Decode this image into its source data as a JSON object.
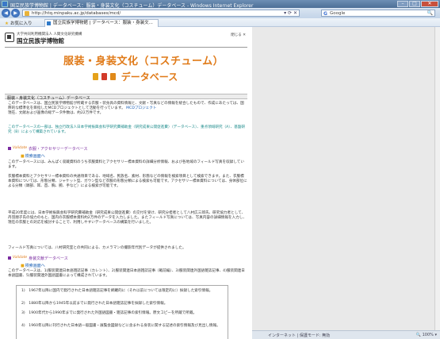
{
  "window": {
    "title": "国立民族学博物館 | データベース：服装・身装文化（コスチューム）データベース - Windows Internet Explorer",
    "minimize": "–",
    "maximize": "□",
    "close": "✕"
  },
  "address": {
    "back": "◀",
    "forward": "▶",
    "url": "http://htq.minpaku.ac.jp/databases/mcd/",
    "tools": "▾ ⟳ ✕"
  },
  "search": {
    "logo": "G",
    "placeholder": "Google",
    "button": "🔍"
  },
  "favorites": {
    "label": "お気に入り"
  },
  "tab": {
    "label": "国立民族学博物館 | データベース：服装・身装文..."
  },
  "site": {
    "sub": "大学共同利用機関法人 人間文化研究機構",
    "name": "国立民族学博物館",
    "close_label": "閉じる ✕"
  },
  "banner": {
    "line1": "服装・身装文化（コスチューム）",
    "line2": "データベース"
  },
  "intro": {
    "heading": "服装・身装文化（コスチューム）データベース",
    "p1": "このデータベースは、国立民族学博物館が所蔵する衣服・装身具の資料情報と、文献・写真などの情報を統合したもので、作成にあたっては、国際的な標準化を目指したMCDプロジェクトとして活動を行っています。",
    "p1_link": "MCDプロジェクト",
    "p1b": "現在、文献および画像の総データ件数は、約22万件です。",
    "p2": "このデータベースの一部は、独立行政法人日本学術振興会科学研究費補助金〈研究成果公開促進費〉（データベース）、重点領域研究（A）、基盤研究（B）によって構築されています。"
  },
  "sec1": {
    "kind": "Validate",
    "title": "衣服・アクセサリーデータベース",
    "search_link": "検索画面へ",
    "p1": "このデータベースには、みんぱく収蔵資料のうち衣服資料とアクセサリー標本資料の詳細分析情報、および各地域のフィールド写真を収録しています。",
    "p2": "衣服標本資料とアクセサリー標本資料の共通項目である、地域名、民族名、素材、形態などの情報を検索項目として検索できます。また、衣服標本資料については、形態分類、ジャケット型、ガウン型など衣服の形態分類による検索も可能です。アクセサリー標本資料については、身体部位による分類（頭部、耳、首、胸、腕、手など）による検索が可能です。",
    "p3": "平成20年度には、日本学術振興会科学研究費補助金（研究成果公開促進費）の交付を受け、研究分担者として八村広三郎氏、研究協力者として、丹羽朋子氏の協力のもと、国内の衣服標本資料約2万件のデータを入力しました。またフィールド写真については、写真内容の詳細情報を入力し、現在の衣服との対応を検討することで、利用しやすいデータベースの構築を行いました。",
    "p4": "フィールド写真については、八村研究室との共同による、カメラマンの撮影年代別データが提供されました。"
  },
  "sec2": {
    "kind": "Validate",
    "title": "身装文献データベース",
    "search_link": "検索画面へ",
    "p1": "このデータベースは、1)服装関連日本語雑誌記事（カレント）、2)服装関連日本語雑誌記事（戦前編）、3)服装関連外国語雑誌記事、4)服装関連日本語図書、5)服装関連外国語図書によって構成されています。",
    "items": [
      "1)　1967年以降に国内で発行された日本語雑誌記事を網羅的に（それ以前については限定的に）採録した索引情報。",
      "2)　1880年以降から1945年以前までに発行された日本語雑誌記事を採録した索引情報。",
      "3)　1900年代から1990年までに発行された外国語図書・雑誌記事の索引情報。原文コピーを所蔵で所蔵。",
      "4)　1960年以降に刊行された日本語一般図書・展覧会図録などに含まれる身装に関する記述の索引情報及び見出し情報。"
    ]
  },
  "status": {
    "text": "インターネット | 保護モード: 無効",
    "zoom": "🔍 100% ▾"
  }
}
